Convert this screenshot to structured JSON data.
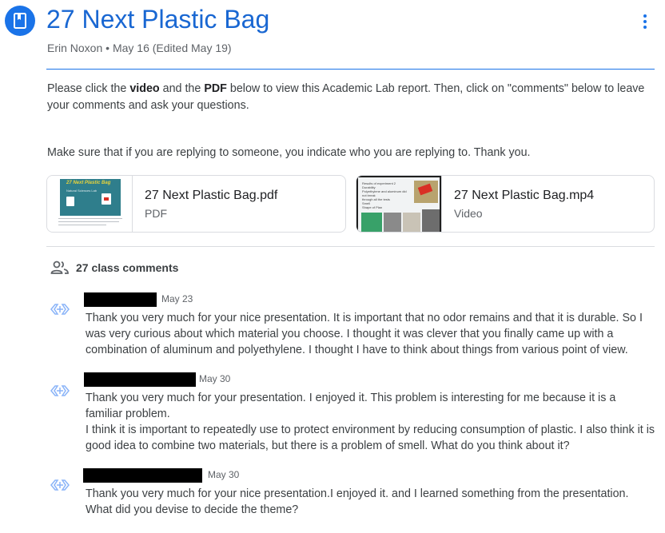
{
  "post": {
    "title": "27 Next Plastic Bag",
    "author": "Erin Noxon",
    "date": "May 16 (Edited May 19)",
    "more_icon": "more-vert-icon",
    "header_icon": "bookmark-icon"
  },
  "description": {
    "line1_part1": "Please click the ",
    "line1_bold1": "video",
    "line1_part2": " and the ",
    "line1_bold2": "PDF",
    "line1_part3": " below to view this Academic Lab report. Then, click on \"comments\" below to leave your comments and ask your questions.",
    "line2": "Make sure that if you are replying to someone, you indicate who you are replying to. Thank you."
  },
  "attachments": [
    {
      "name": "27 Next Plastic Bag.pdf",
      "type": "PDF",
      "thumb_title": "27 Next Plastic Bag",
      "thumb_subtitle": "Natural Sciences Lab"
    },
    {
      "name": "27 Next Plastic Bag.mp4",
      "type": "Video",
      "thumb_lines": [
        "Results of experiment 2",
        "Durability",
        "Polyethylene and aluminum did not break",
        "through all the tests",
        "Smell",
        "Shape of Plan"
      ]
    }
  ],
  "comments_header": {
    "label": "27 class comments",
    "icon": "people-icon"
  },
  "comments": [
    {
      "date": "May 23",
      "avatar_icon": "default-avatar-icon",
      "body": [
        "Thank you very much for your nice presentation. It is important that no odor remains and that it is durable. So I was very curious about which material you choose. I thought it was clever that you finally came up with a combination of aluminum and polyethylene. I thought I have to think about things from various point of view."
      ]
    },
    {
      "date": "May 30",
      "avatar_icon": "default-avatar-icon",
      "body": [
        "Thank you very much for your presentation. I enjoyed it. This problem is interesting for me because it is a familiar problem.",
        "I think it is important to repeatedly use to protect environment by reducing consumption of plastic. I also think it is good idea to combine two materials, but there is a problem of smell. What do you think about it?"
      ]
    },
    {
      "date": "May 30",
      "avatar_icon": "default-avatar-icon",
      "body": [
        "Thank you very much for your nice presentation.I enjoyed it. and I learned something from the presentation. What did you devise to decide the theme?"
      ]
    }
  ],
  "colors": {
    "accent": "#1a73e8",
    "title": "#1967d2",
    "text": "#3c4043",
    "muted": "#5f6368",
    "border": "#dadce0"
  }
}
